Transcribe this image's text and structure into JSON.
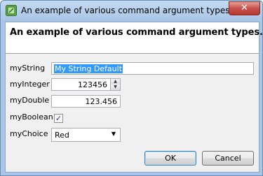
{
  "window": {
    "title": "An example of various command argument types."
  },
  "header": {
    "text": "An example of various command argument types."
  },
  "form": {
    "myString": {
      "label": "myString",
      "value": "My String Default"
    },
    "myInteger": {
      "label": "myInteger",
      "value": "123456"
    },
    "myDouble": {
      "label": "myDouble",
      "value": "123.456"
    },
    "myBoolean": {
      "label": "myBoolean",
      "checked": true
    },
    "myChoice": {
      "label": "myChoice",
      "value": "Red"
    }
  },
  "buttons": {
    "ok": "OK",
    "cancel": "Cancel"
  },
  "icons": {
    "app": "app-icon",
    "close": "close-icon",
    "spin_up": "chevron-up-icon",
    "spin_down": "chevron-down-icon",
    "dropdown": "dropdown-arrow-icon",
    "check": "checkmark-icon"
  },
  "colors": {
    "selection": "#3399ff",
    "close_button": "#c75050"
  }
}
